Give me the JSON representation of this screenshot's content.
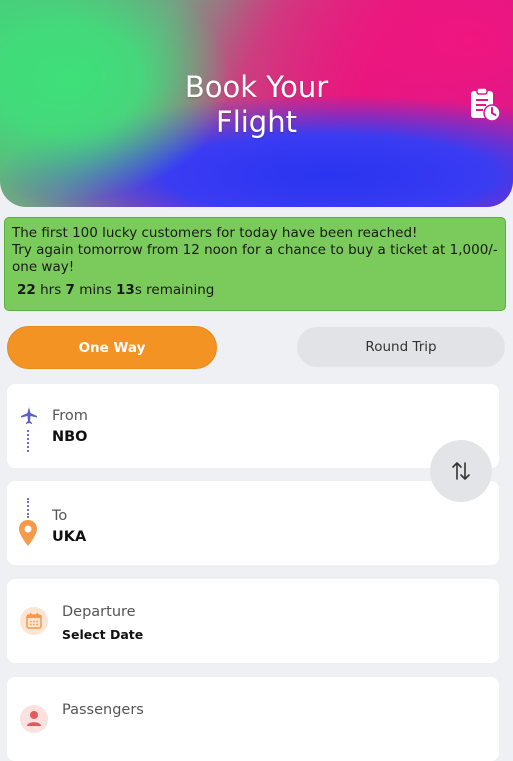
{
  "hero": {
    "title": "Book Your\nFlight",
    "history_icon": "clipboard-clock-icon"
  },
  "promo": {
    "line1": "The first 100 lucky customers for today have been reached!",
    "line2": "Try again tomorrow from 12 noon for a chance to buy a ticket at 1,000/- one way!",
    "hours": "22",
    "hours_unit": "hrs",
    "mins": "7",
    "mins_unit": "mins",
    "secs": "13",
    "secs_unit": "s",
    "remaining": "remaining"
  },
  "trip_type": {
    "one_way": "One Way",
    "round_trip": "Round Trip",
    "selected": "One Way"
  },
  "from": {
    "label": "From",
    "value": "NBO",
    "icon": "airplane-icon"
  },
  "to": {
    "label": "To",
    "value": "UKA",
    "icon": "location-pin-icon"
  },
  "swap_icon": "swap-arrows-icon",
  "departure": {
    "label": "Departure",
    "value": "Select Date",
    "icon": "calendar-icon"
  },
  "passengers": {
    "label": "Passengers",
    "icon": "person-icon"
  },
  "colors": {
    "accent": "#f39324",
    "promo_bg": "#7acb5b",
    "plane": "#5b5fc7",
    "pin": "#f59a4a"
  }
}
